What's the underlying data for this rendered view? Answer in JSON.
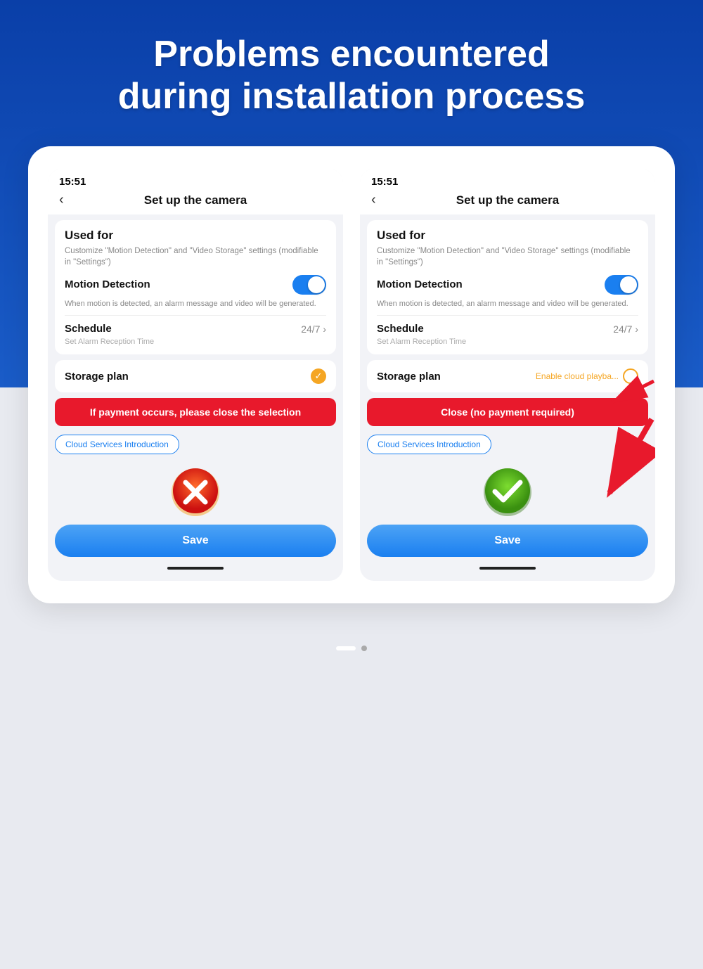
{
  "header": {
    "title_line1": "Problems encountered",
    "title_line2": "during installation process"
  },
  "left_phone": {
    "time": "15:51",
    "nav_back": "‹",
    "nav_title": "Set up  the camera",
    "used_for_title": "Used for",
    "used_for_subtitle": "Customize \"Motion Detection\" and \"Video Storage\" settings (modifiable in \"Settings\")",
    "motion_detection_label": "Motion Detection",
    "motion_detection_desc": "When motion is detected, an alarm message and video will be generated.",
    "schedule_label": "Schedule",
    "schedule_value": "24/7 ›",
    "schedule_sub": "Set Alarm Reception Time",
    "storage_label": "Storage plan",
    "alert_banner": "If payment occurs, please close the selection",
    "cloud_intro_btn": "Cloud Services Introduction",
    "save_label": "Save"
  },
  "right_phone": {
    "time": "15:51",
    "nav_back": "‹",
    "nav_title": "Set up  the camera",
    "used_for_title": "Used for",
    "used_for_subtitle": "Customize \"Motion Detection\" and \"Video Storage\" settings (modifiable in \"Settings\")",
    "motion_detection_label": "Motion Detection",
    "motion_detection_desc": "When motion is detected, an alarm message and video will be generated.",
    "schedule_label": "Schedule",
    "schedule_value": "24/7 ›",
    "schedule_sub": "Set Alarm Reception Time",
    "storage_label": "Storage plan",
    "enable_cloud_text": "Enable cloud playba...",
    "alert_banner": "Close (no payment required)",
    "cloud_intro_btn": "Cloud Services Introduction",
    "save_label": "Save"
  },
  "pagination": {
    "active_dot": "white",
    "inactive_dot": "#aaa"
  }
}
